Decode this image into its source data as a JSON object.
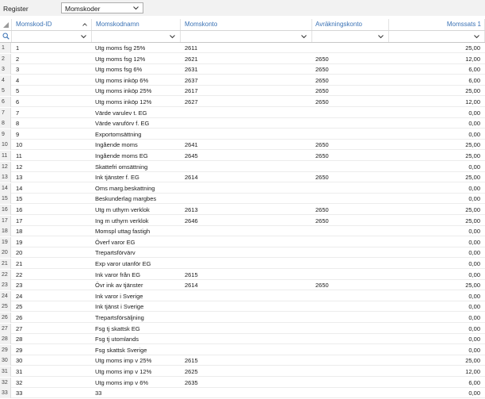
{
  "toolbar": {
    "register_label": "Register",
    "register_value": "Momskoder"
  },
  "columns": {
    "id": "Momskod-ID",
    "name": "Momskodnamn",
    "konto": "Momskonto",
    "avr": "Avräkningskonto",
    "sats": "Momssats 1"
  },
  "rows": [
    {
      "n": "1",
      "id": "1",
      "name": "Utg moms fsg 25%",
      "konto": "2611",
      "avr": "",
      "sats": "25,00"
    },
    {
      "n": "2",
      "id": "2",
      "name": "Utg moms fsg 12%",
      "konto": "2621",
      "avr": "2650",
      "sats": "12,00"
    },
    {
      "n": "3",
      "id": "3",
      "name": "Utg moms fsg 6%",
      "konto": "2631",
      "avr": "2650",
      "sats": "6,00"
    },
    {
      "n": "4",
      "id": "4",
      "name": "Utg moms inköp 6%",
      "konto": "2637",
      "avr": "2650",
      "sats": "6,00"
    },
    {
      "n": "5",
      "id": "5",
      "name": "Utg moms inköp 25%",
      "konto": "2617",
      "avr": "2650",
      "sats": "25,00"
    },
    {
      "n": "6",
      "id": "6",
      "name": "Utg moms inköp 12%",
      "konto": "2627",
      "avr": "2650",
      "sats": "12,00"
    },
    {
      "n": "7",
      "id": "7",
      "name": "Värde varulev t. EG",
      "konto": "",
      "avr": "",
      "sats": "0,00"
    },
    {
      "n": "8",
      "id": "8",
      "name": "Värde varuförv f. EG",
      "konto": "",
      "avr": "",
      "sats": "0,00"
    },
    {
      "n": "9",
      "id": "9",
      "name": "Exportomsättning",
      "konto": "",
      "avr": "",
      "sats": "0,00"
    },
    {
      "n": "10",
      "id": "10",
      "name": "Ingående moms",
      "konto": "2641",
      "avr": "2650",
      "sats": "25,00"
    },
    {
      "n": "11",
      "id": "11",
      "name": "Ingående moms EG",
      "konto": "2645",
      "avr": "2650",
      "sats": "25,00"
    },
    {
      "n": "12",
      "id": "12",
      "name": "Skattefri omsättning",
      "konto": "",
      "avr": "",
      "sats": "0,00"
    },
    {
      "n": "13",
      "id": "13",
      "name": "Ink tjänster f. EG",
      "konto": "2614",
      "avr": "2650",
      "sats": "25,00"
    },
    {
      "n": "14",
      "id": "14",
      "name": "Oms marg.beskattning",
      "konto": "",
      "avr": "",
      "sats": "0,00"
    },
    {
      "n": "15",
      "id": "15",
      "name": "Beskunderlag margbes",
      "konto": "",
      "avr": "",
      "sats": "0,00"
    },
    {
      "n": "16",
      "id": "16",
      "name": "Utg m uthyrn verklok",
      "konto": "2613",
      "avr": "2650",
      "sats": "25,00"
    },
    {
      "n": "17",
      "id": "17",
      "name": "Ing m uthyrn verklok",
      "konto": "2646",
      "avr": "2650",
      "sats": "25,00"
    },
    {
      "n": "18",
      "id": "18",
      "name": "Momspl uttag fastigh",
      "konto": "",
      "avr": "",
      "sats": "0,00"
    },
    {
      "n": "19",
      "id": "19",
      "name": "Överf varor EG",
      "konto": "",
      "avr": "",
      "sats": "0,00"
    },
    {
      "n": "20",
      "id": "20",
      "name": "Trepartsförvärv",
      "konto": "",
      "avr": "",
      "sats": "0,00"
    },
    {
      "n": "21",
      "id": "21",
      "name": "Exp varor utanför EG",
      "konto": "",
      "avr": "",
      "sats": "0,00"
    },
    {
      "n": "22",
      "id": "22",
      "name": "Ink varor från EG",
      "konto": "2615",
      "avr": "",
      "sats": "0,00"
    },
    {
      "n": "23",
      "id": "23",
      "name": "Övr ink av tjänster",
      "konto": "2614",
      "avr": "2650",
      "sats": "25,00"
    },
    {
      "n": "24",
      "id": "24",
      "name": "Ink varor i Sverige",
      "konto": "",
      "avr": "",
      "sats": "0,00"
    },
    {
      "n": "25",
      "id": "25",
      "name": "Ink tjänst i Sverige",
      "konto": "",
      "avr": "",
      "sats": "0,00"
    },
    {
      "n": "26",
      "id": "26",
      "name": "Trepartsförsäljning",
      "konto": "",
      "avr": "",
      "sats": "0,00"
    },
    {
      "n": "27",
      "id": "27",
      "name": "Fsg tj skattsk EG",
      "konto": "",
      "avr": "",
      "sats": "0,00"
    },
    {
      "n": "28",
      "id": "28",
      "name": "Fsg tj utomlands",
      "konto": "",
      "avr": "",
      "sats": "0,00"
    },
    {
      "n": "29",
      "id": "29",
      "name": "Fsg skattsk Sverige",
      "konto": "",
      "avr": "",
      "sats": "0,00"
    },
    {
      "n": "30",
      "id": "30",
      "name": "Utg moms imp v 25%",
      "konto": "2615",
      "avr": "",
      "sats": "25,00"
    },
    {
      "n": "31",
      "id": "31",
      "name": "Utg moms imp v 12%",
      "konto": "2625",
      "avr": "",
      "sats": "12,00"
    },
    {
      "n": "32",
      "id": "32",
      "name": "Utg moms imp v 6%",
      "konto": "2635",
      "avr": "",
      "sats": "6,00"
    },
    {
      "n": "33",
      "id": "33",
      "name": "33",
      "konto": "",
      "avr": "",
      "sats": "0,00"
    }
  ]
}
